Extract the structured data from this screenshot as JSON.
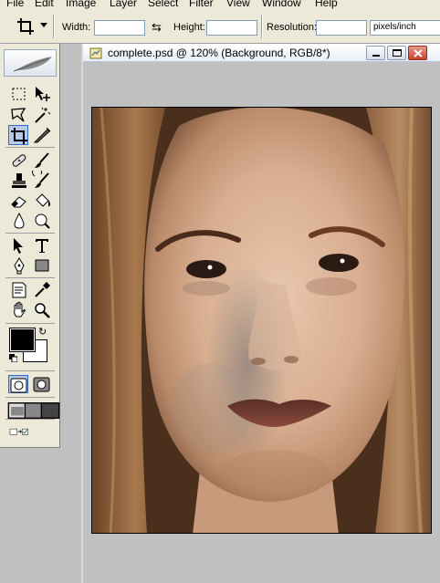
{
  "menu": {
    "items": [
      "File",
      "Edit",
      "Image",
      "Layer",
      "Select",
      "Filter",
      "View",
      "Window",
      "Help"
    ]
  },
  "options": {
    "width_label": "Width:",
    "width_value": "",
    "height_label": "Height:",
    "height_value": "",
    "resolution_label": "Resolution:",
    "resolution_value": "",
    "units_value": "pixels/inch"
  },
  "document": {
    "title": "complete.psd @ 120% (Background, RGB/8*)"
  },
  "tools": {
    "foreground_color": "#000000",
    "background_color": "#ffffff",
    "active_tool": "crop-tool"
  },
  "colors": {
    "panel_bg": "#ece9d8",
    "workspace_bg": "#c0c0c0",
    "selection_blue": "#316ac5"
  }
}
